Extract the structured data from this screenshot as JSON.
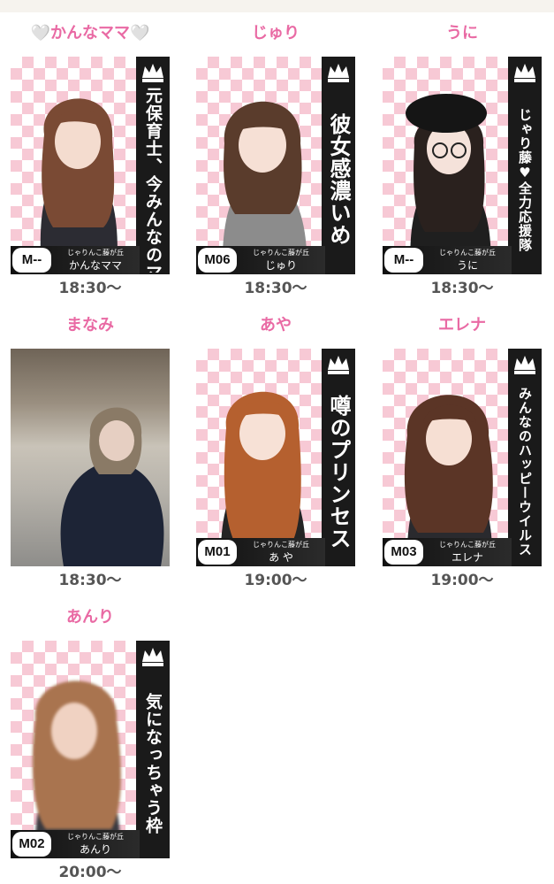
{
  "casts": [
    {
      "name": "🤍かんなママ🤍",
      "catch": "元保育士、今みんなのママ",
      "badge": "M--",
      "shop": "じゃりんこ藤が丘",
      "castname": "かんなママ",
      "time": "18:30〜"
    },
    {
      "name": "じゅり",
      "catch": "彼女感濃いめ",
      "badge": "M06",
      "shop": "じゃりんこ藤が丘",
      "castname": "じゅり",
      "time": "18:30〜"
    },
    {
      "name": "うに",
      "catch": "じゃり藤♥全力応援隊",
      "badge": "M--",
      "shop": "じゃりんこ藤が丘",
      "castname": "うに",
      "time": "18:30〜"
    },
    {
      "name": "まなみ",
      "time": "18:30〜"
    },
    {
      "name": "あや",
      "catch": "噂のプリンセス",
      "badge": "M01",
      "shop": "じゃりんこ藤が丘",
      "castname": "あ や",
      "time": "19:00〜"
    },
    {
      "name": "エレナ",
      "catch": "みんなのハッピーウイルス",
      "badge": "M03",
      "shop": "じゃりんこ藤が丘",
      "castname": "エレナ",
      "time": "19:00〜"
    },
    {
      "name": "あんり",
      "catch": "気になっちゃう枠",
      "badge": "M02",
      "shop": "じゃりんこ藤が丘",
      "castname": "あんり",
      "time": "20:00〜"
    }
  ],
  "colors": {
    "name_pink": "#e96aa4",
    "time_gray": "#555555",
    "checker_pink": "#f7c9d5",
    "band_black": "#1a1a1a"
  },
  "icons": {
    "crest": "crown-crest-icon"
  }
}
